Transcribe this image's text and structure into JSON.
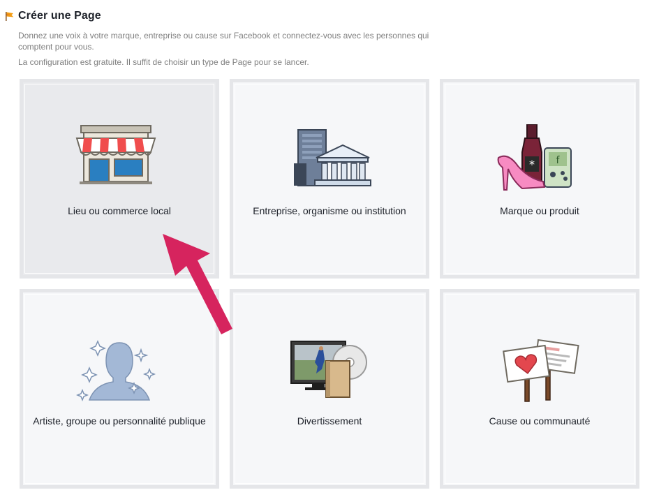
{
  "header": {
    "title": "Créer une Page",
    "icon": "orange-flag-icon"
  },
  "description": {
    "line1": "Donnez une voix à votre marque, entreprise ou cause sur Facebook et connectez-vous avec les personnes qui comptent pour vous.",
    "line2": "La configuration est gratuite. Il suffit de choisir un type de Page pour se lancer."
  },
  "categories": [
    {
      "label": "Lieu ou commerce local",
      "icon": "storefront-icon"
    },
    {
      "label": "Entreprise, organisme ou institution",
      "icon": "building-icon"
    },
    {
      "label": "Marque ou produit",
      "icon": "products-icon"
    },
    {
      "label": "Artiste, groupe ou personnalité publique",
      "icon": "person-silhouette-icon"
    },
    {
      "label": "Divertissement",
      "icon": "entertainment-icon"
    },
    {
      "label": "Cause ou communauté",
      "icon": "signs-icon"
    }
  ],
  "colors": {
    "accent_arrow": "#d6245e",
    "card_border": "#e5e6e9",
    "card_bg": "#f6f7f9"
  }
}
